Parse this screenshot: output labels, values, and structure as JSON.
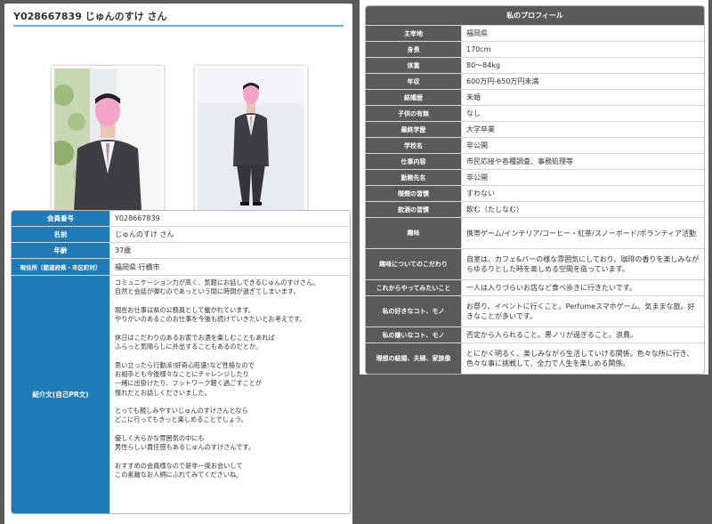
{
  "member": {
    "heading": "Y028667839 じゅんのすけ さん"
  },
  "profile_table": [
    {
      "label": "会員番号",
      "value": "Y028667839"
    },
    {
      "label": "名前",
      "value": "じゅんのすけ さん"
    },
    {
      "label": "年齢",
      "value": "37歳"
    },
    {
      "label": "現住所（都道府県・市区町村）",
      "value": "福岡県 行橋市"
    },
    {
      "label": "紹介文(自己PR文)",
      "value": "コミュニケーション力が高く、気軽にお話しできるじゅんのすけさん。\n自然と会話が弾むのであっという間に時間が過ぎてしまいます。\n\n現在お仕事は県の公務員として働かれています。\nやりがいのあるこのお仕事を今後も続けていきたいとお考えです。\n\n休日はこだわりのあるお家でお酒を楽しむこともあれば\nふらっと気晴らしに外出することもあるのだとか。\n\n思い立ったら行動派!好奇心旺盛!など性格なので\nお相手とも今後様々なことにチャレンジしたり\n一緒に出掛けたり、フットワーク軽く過ごすことが\n憧れだとお話しくださいました。\n\nとっても親しみやすいじゅんのすけさんとなら\nどこに行ってもきっと楽しめることでしょう。\n\n優しく大らかな雰囲気の中にも\n男性らしい責任感もあるじゅんのすけさんです。\n\nおすすめの会員様なので是非一度お会いして\nこの素敵なお人柄にふれてみてくださいね。"
    }
  ],
  "my_profile": {
    "caption": "私のプロフィール",
    "rows": [
      {
        "label": "主宰地",
        "value": "福岡県"
      },
      {
        "label": "身長",
        "value": "170cm"
      },
      {
        "label": "体重",
        "value": "80～84kg"
      },
      {
        "label": "年収",
        "value": "600万円-650万円未満"
      },
      {
        "label": "結婚歴",
        "value": "未婚"
      },
      {
        "label": "子供の有無",
        "value": "なし"
      },
      {
        "label": "最終学歴",
        "value": "大学卒業"
      },
      {
        "label": "学校名",
        "value": "非公開"
      },
      {
        "label": "仕事内容",
        "value": "市民応接や各種調査、事務処理等"
      },
      {
        "label": "勤務先名",
        "value": "非公開"
      },
      {
        "label": "喫煙の習慣",
        "value": "すわない"
      },
      {
        "label": "飲酒の習慣",
        "value": "飲む（たしなむ）"
      },
      {
        "label": "趣味",
        "value": "携帯ゲーム/インテリア/コーヒー・紅茶/スノーボード/ボランティア活動"
      },
      {
        "label": "趣味についてのこだわり",
        "value": "自室は、カフェ&バーの様な雰囲気にしており、珈琲の香りを楽しみながらゆるりとした時を楽しめる空間を造っています。"
      },
      {
        "label": "これからやってみたいこと",
        "value": "一人は入りづらいお店など食べ歩きに行きたいです。"
      },
      {
        "label": "私の好きなコト、モノ",
        "value": "お祭り、イベントに行くこと。Perfumeスマホゲーム、気ままな旅。好きなことが多いです。"
      },
      {
        "label": "私の嫌いなコト、モノ",
        "value": "否定から入られること。悪ノリが過ぎること。浪費。"
      },
      {
        "label": "理想の結婚、夫婦、家族像",
        "value": "とにかく明るく、楽しみながら生活していける関係。色々な所に行き、色々な事に挑戦して、全力で人生を楽しめる関係。"
      }
    ]
  }
}
